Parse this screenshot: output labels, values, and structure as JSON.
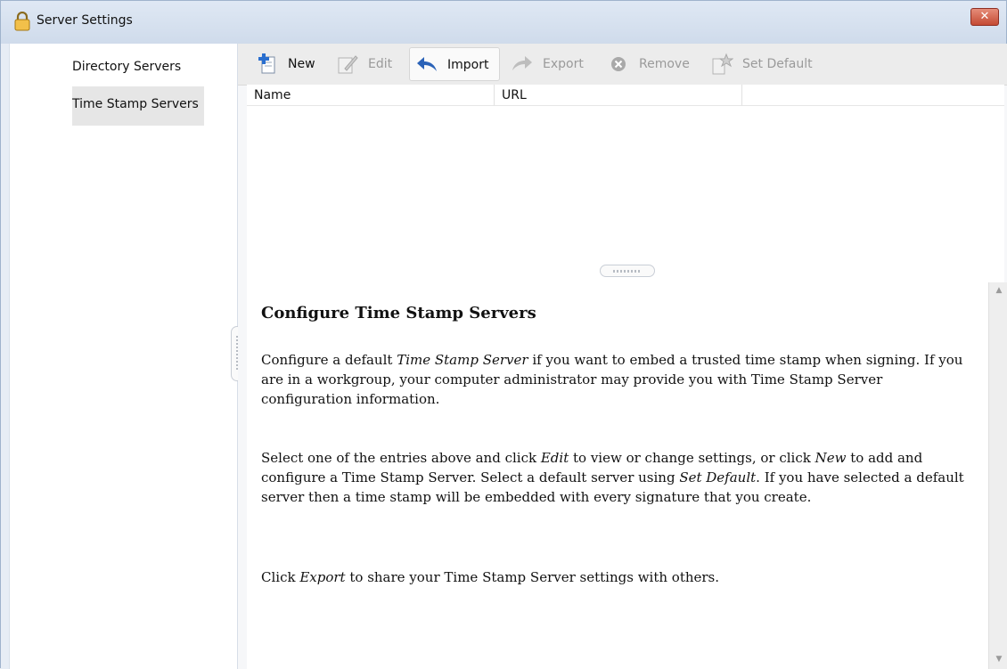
{
  "window": {
    "title": "Server Settings"
  },
  "sidebar": {
    "items": [
      {
        "label": "Directory Servers"
      },
      {
        "label": "Time Stamp Servers",
        "selected": true
      }
    ]
  },
  "toolbar": {
    "new_label": "New",
    "edit_label": "Edit",
    "import_label": "Import",
    "export_label": "Export",
    "remove_label": "Remove",
    "set_default_label": "Set Default"
  },
  "table": {
    "columns": [
      "Name",
      "URL",
      ""
    ],
    "rows": []
  },
  "help": {
    "title": "Configure Time Stamp Servers",
    "p1": {
      "a": "Configure a default ",
      "b": "Time Stamp Server",
      "c": " if you want to embed a trusted time stamp when signing. If you are in a workgroup, your computer administrator may provide you with Time Stamp Server configuration information."
    },
    "p2": {
      "a": "Select one of the entries above and click ",
      "b": "Edit",
      "c": " to view or change settings, or click ",
      "d": "New",
      "e": " to add and configure a Time Stamp Server. Select a default server using ",
      "f": "Set Default",
      "g": ". If you have selected a default server then a time stamp will be embedded with every signature that you create."
    },
    "p3": {
      "a": "Click ",
      "b": "Export",
      "c": " to share your Time Stamp Server settings with others."
    }
  }
}
